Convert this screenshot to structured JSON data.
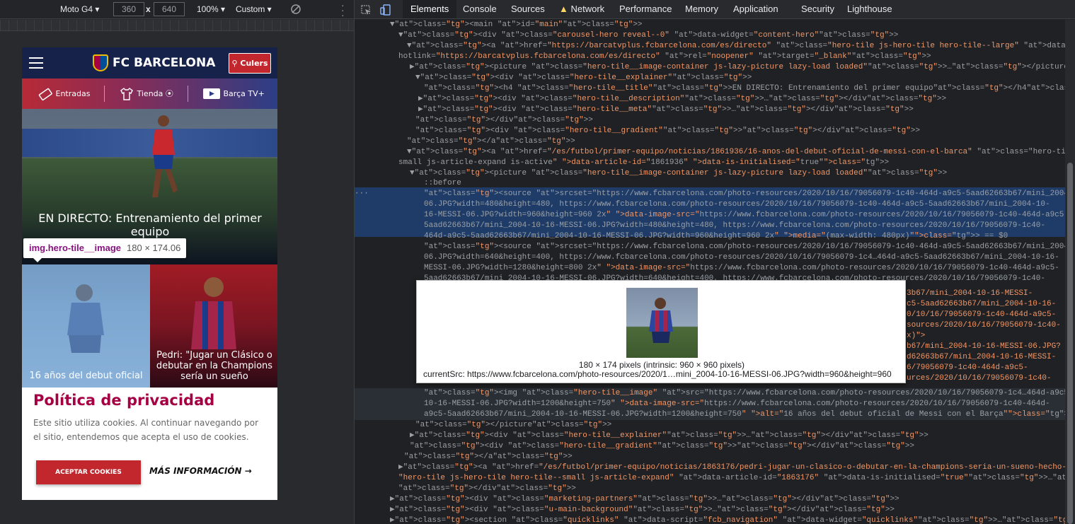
{
  "devtools_toolbar": {
    "device": "Moto G4",
    "width": "360",
    "x": "x",
    "height": "640",
    "zoom": "100%",
    "throttle": "Custom"
  },
  "tabs": [
    "Elements",
    "Console",
    "Sources",
    "Network",
    "Performance",
    "Memory",
    "Application",
    "Security",
    "Lighthouse"
  ],
  "site": {
    "brand": "FC BARCELONA",
    "culers": "Culers",
    "nav": [
      "Entradas",
      "Tienda",
      "Barça TV+"
    ],
    "hero_title": "EN DIRECTO: Entrenamiento del primer equipo",
    "tile1_caption": "16 años del debut oficial",
    "tile2_caption": "Pedri: \"Jugar un Clásico o debutar en la Champions sería un sueño",
    "cookie": {
      "title": "Política de privacidad",
      "text": "Este sitio utiliza cookies. Al continuar navegando por el sitio, entendemos que acepta el uso de cookies.",
      "accept": "ACEPTAR COOKIES",
      "more": "MÁS INFORMACIÓN"
    }
  },
  "inspect_tooltip": {
    "selector": "img.hero-tile__image",
    "size": "180 × 174.06"
  },
  "image_popover": {
    "dims": "180 × 174 pixels (intrinsic: 960 × 960 pixels)",
    "current_src": "currentSrc: https://www.fcbarcelona.com/photo-resources/2020/1…mini_2004-10-16-MESSI-06.JPG?width=960&height=960"
  },
  "code_lines": [
    "▼<main id=\"main\">",
    "▼<div class=\"carousel-hero reveal--0\" data-widget=\"content-hero\">",
    "▼<a href=\"https://barcatvplus.fcbarcelona.com/es/directo\" class=\"hero-tile js-hero-tile hero-tile--large\" data-article-id=\"1678861\" data-",
    "hotlink=\"https://barcatvplus.fcbarcelona.com/es/directo\" rel=\"noopener\" target=\"_blank\">",
    "▶<picture class=\"hero-tile__image-container js-lazy-picture lazy-load loaded\">…</picture>",
    "▼<div class=\"hero-tile__explainer\">",
    "<h4 class=\"hero-tile__title\">EN DIRECTO: Entrenamiento del primer equipo</h4>",
    "▶<div class=\"hero-tile__description\">…</div>",
    "▶<div class=\"hero-tile__meta\">…</div>",
    "</div>",
    "<div class=\"hero-tile__gradient\"></div>",
    "</a>",
    "▼<a href=\"/es/futbol/primer-equipo/noticias/1861936/16-anos-del-debut-oficial-de-messi-con-el-barca\" class=\"hero-tile js-hero-tile hero-tile--",
    "small js-article-expand is-active\" data-article-id=\"1861936\" data-is-initialised=\"true\">",
    "▼<picture class=\"hero-tile__image-container js-lazy-picture lazy-load loaded\">",
    "::before",
    "<source srcset=\"https://www.fcbarcelona.com/photo-resources/2020/10/16/79056079-1c40-464d-a9c5-5aad62663b67/mini_2004-10-16-MESSI-",
    "06.JPG?width=480&height=480, https://www.fcbarcelona.com/photo-resources/2020/10/16/79056079-1c40-464d-a9c5-5aad62663b67/mini_2004-10-",
    "16-MESSI-06.JPG?width=960&height=960 2x\" data-image-src=\"https://www.fcbarcelona.com/photo-resources/2020/10/16/79056079-1c40-464d-a9c5-",
    "5aad62663b67/mini_2004-10-16-MESSI-06.JPG?width=480&height=480, https://www.fcbarcelona.com/photo-resources/2020/10/16/79056079-1c40-",
    "464d-a9c5-5aad62663b67/mini_2004-10-16-MESSI-06.JPG?width=960&height=960 2x\" media=\"(max-width: 480px)\"> == $0",
    "<source srcset=\"https://www.fcbarcelona.com/photo-resources/2020/10/16/79056079-1c40-464d-a9c5-5aad62663b67/mini_2004-10-16-MESSI-",
    "06.JPG?width=640&height=400, https://www.fcbarcelona.com/photo-resources/2020/10/16/79056079-1c4…464d-a9c5-5aad62663b67/mini_2004-10-16-",
    "MESSI-06.JPG?width=1280&height=800 2x\" data-image-src=\"https://www.fcbarcelona.com/photo-resources/2020/10/16/79056079-1c40-464d-a9c5-",
    "5aad62663b67/mini_2004-10-16-MESSI-06.JPG?width=640&height=400, https://www.fcbarcelona.com/photo-resources/2020/10/16/79056079-1c40-",
    "<img class=\"hero-tile__image\" src=\"https://www.fcbarcelona.com/photo-resources/2020/10/16/79056079-1c4…464d-a9c5-5aad62663b67/mini_2004-",
    "10-16-MESSI-06.JPG?width=1200&height=750\" data-image-src=\"https://www.fcbarcelona.com/photo-resources/2020/10/16/79056079-1c40-464d-",
    "a9c5-5aad62663b67/mini_2004-10-16-MESSI-06.JPG?width=1200&height=750\" alt=\"16 años del debut oficial de Messi con el Barça\">",
    "</picture>",
    "▶<div class=\"hero-tile__explainer\">…</div>",
    "<div class=\"hero-tile__gradient\"></div>",
    "</a>",
    "▶<a href=\"/es/futbol/primer-equipo/noticias/1863176/pedri-jugar-un-clasico-o-debutar-en-la-champions-seria-un-sueno-hecho-realidad\" class=",
    "\"hero-tile js-hero-tile hero-tile--small js-article-expand\" data-article-id=\"1863176\" data-is-initialised=\"true\">…</a>",
    "</div>",
    "▶<div class=\"marketing-partners\">…</div>",
    "▶<div class=\"u-main-background\">…</div>",
    "▶<section class=\"quicklinks\" data-script=\"fcb_navigation\" data-widget=\"quicklinks\">…</section>"
  ],
  "code_right_fragments": [
    "3b67/mini_2004-10-16-MESSI-",
    "c5-5aad62663b67/mini_2004-10-16-",
    "0/10/16/79056079-1c40-464d-a9c5-",
    "sources/2020/10/16/79056079-1c40-",
    "x)\">",
    "b67/mini_2004-10-16-MESSI-06.JPG?",
    "d62663b67/mini_2004-10-16-MESSI-",
    "6/79056079-1c40-464d-a9c5-",
    "urces/2020/10/16/79056079-1c40-"
  ],
  "colors": {
    "accent": "#a50044",
    "brand_blue": "#16224a",
    "button_red": "#c1272d"
  }
}
